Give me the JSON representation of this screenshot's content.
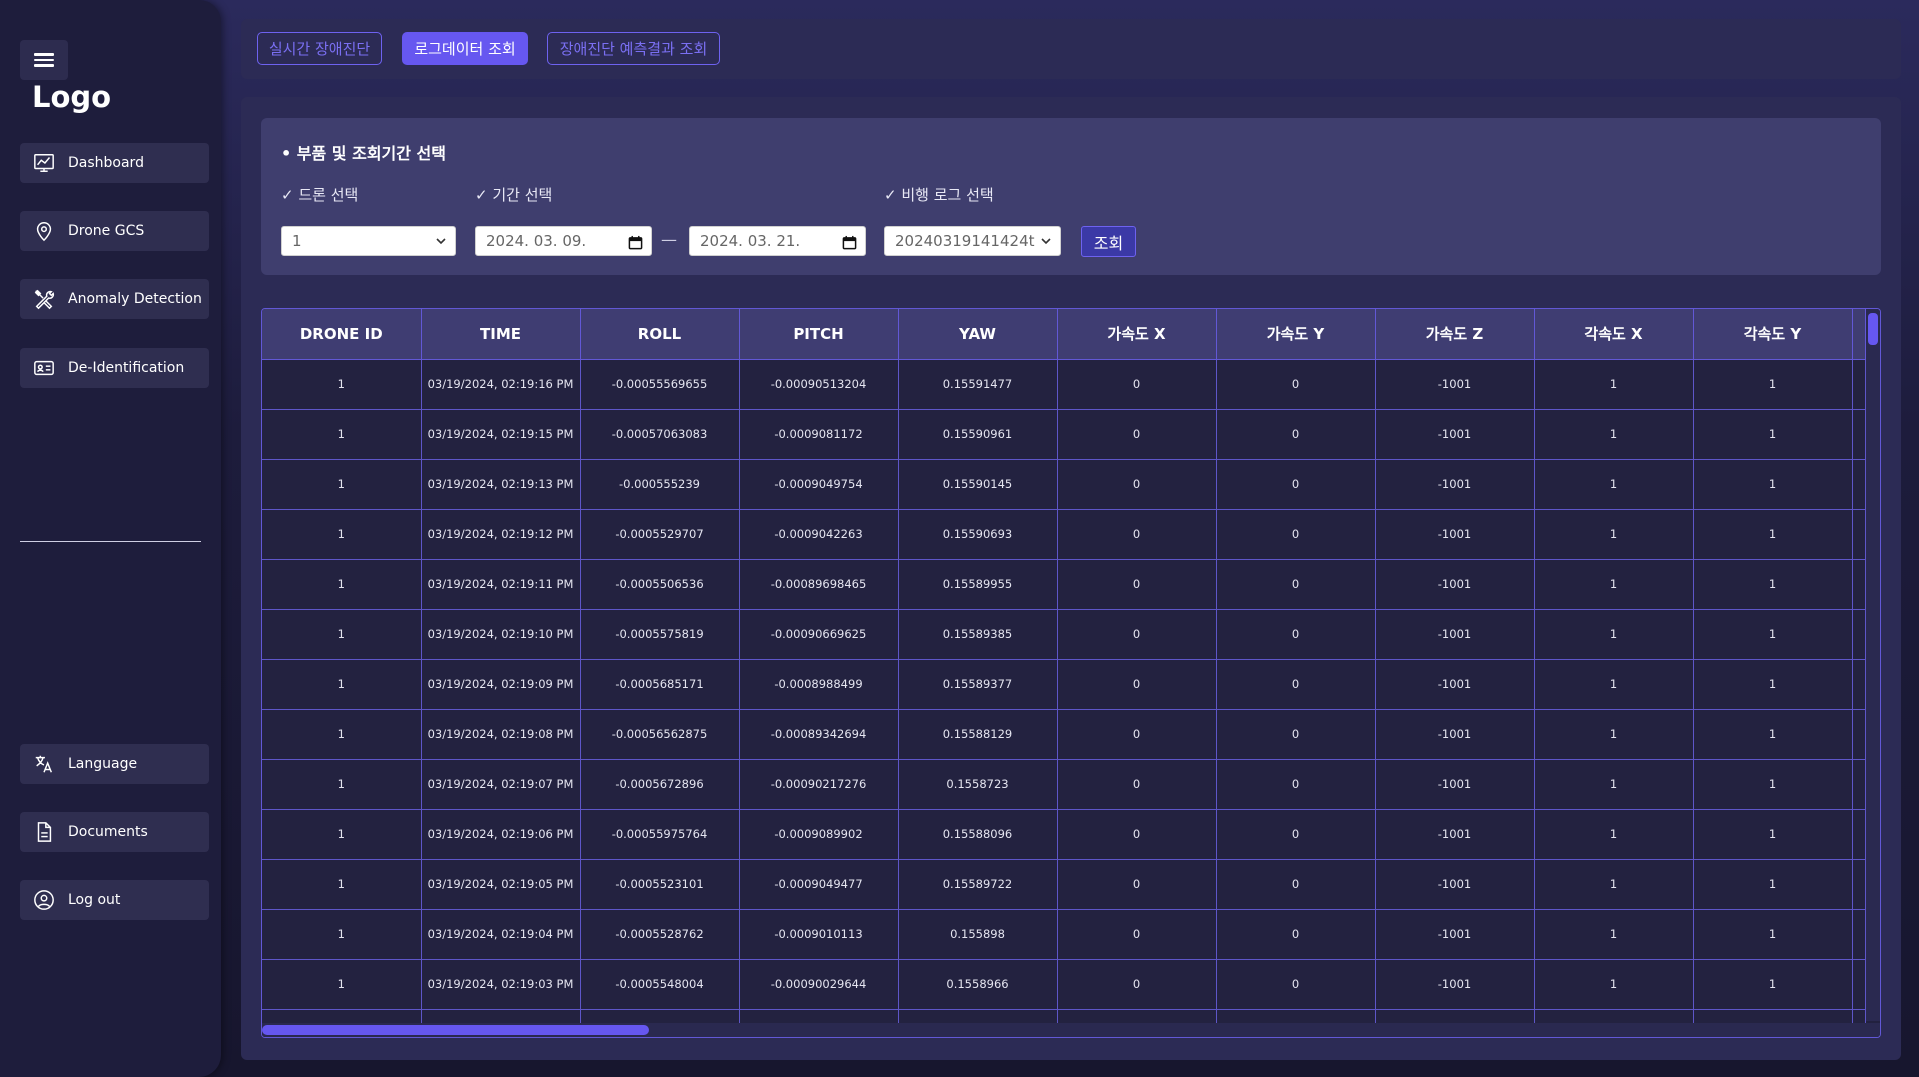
{
  "sidebar": {
    "logo": "Logo",
    "nav_top": [
      {
        "label": "Dashboard",
        "icon": "chart-icon"
      },
      {
        "label": "Drone GCS",
        "icon": "location-pin-icon"
      },
      {
        "label": "Anomaly Detection",
        "icon": "tools-icon"
      },
      {
        "label": "De-Identification",
        "icon": "id-card-icon"
      }
    ],
    "nav_bottom": [
      {
        "label": "Language",
        "icon": "translate-icon"
      },
      {
        "label": "Documents",
        "icon": "document-icon"
      },
      {
        "label": "Log out",
        "icon": "user-circle-icon"
      }
    ]
  },
  "tabs": [
    {
      "label": "실시간 장애진단",
      "active": false
    },
    {
      "label": "로그데이터 조회",
      "active": true
    },
    {
      "label": "장애진단 예측결과 조회",
      "active": false
    }
  ],
  "filter": {
    "title": "• 부품 및 조회기간 선택",
    "drone_label": "✓ 드론 선택",
    "period_label": "✓ 기간 선택",
    "log_label": "✓ 비행 로그 선택",
    "drone_value": "1",
    "start_date": "2024. 03. 09.",
    "date_separator": "—",
    "end_date": "2024. 03. 21.",
    "log_value": "20240319141424t",
    "search_button": "조회"
  },
  "table": {
    "columns": [
      "DRONE ID",
      "TIME",
      "ROLL",
      "PITCH",
      "YAW",
      "가속도 X",
      "가속도 Y",
      "가속도 Z",
      "각속도 X",
      "각속도 Y"
    ],
    "rows": [
      [
        "1",
        "03/19/2024, 02:19:16 PM",
        "-0.00055569655",
        "-0.00090513204",
        "0.15591477",
        "0",
        "0",
        "-1001",
        "1",
        "1"
      ],
      [
        "1",
        "03/19/2024, 02:19:15 PM",
        "-0.00057063083",
        "-0.0009081172",
        "0.15590961",
        "0",
        "0",
        "-1001",
        "1",
        "1"
      ],
      [
        "1",
        "03/19/2024, 02:19:13 PM",
        "-0.000555239",
        "-0.0009049754",
        "0.15590145",
        "0",
        "0",
        "-1001",
        "1",
        "1"
      ],
      [
        "1",
        "03/19/2024, 02:19:12 PM",
        "-0.0005529707",
        "-0.0009042263",
        "0.15590693",
        "0",
        "0",
        "-1001",
        "1",
        "1"
      ],
      [
        "1",
        "03/19/2024, 02:19:11 PM",
        "-0.0005506536",
        "-0.00089698465",
        "0.15589955",
        "0",
        "0",
        "-1001",
        "1",
        "1"
      ],
      [
        "1",
        "03/19/2024, 02:19:10 PM",
        "-0.0005575819",
        "-0.00090669625",
        "0.15589385",
        "0",
        "0",
        "-1001",
        "1",
        "1"
      ],
      [
        "1",
        "03/19/2024, 02:19:09 PM",
        "-0.0005685171",
        "-0.0008988499",
        "0.15589377",
        "0",
        "0",
        "-1001",
        "1",
        "1"
      ],
      [
        "1",
        "03/19/2024, 02:19:08 PM",
        "-0.00056562875",
        "-0.00089342694",
        "0.15588129",
        "0",
        "0",
        "-1001",
        "1",
        "1"
      ],
      [
        "1",
        "03/19/2024, 02:19:07 PM",
        "-0.0005672896",
        "-0.00090217276",
        "0.1558723",
        "0",
        "0",
        "-1001",
        "1",
        "1"
      ],
      [
        "1",
        "03/19/2024, 02:19:06 PM",
        "-0.00055975764",
        "-0.0009089902",
        "0.15588096",
        "0",
        "0",
        "-1001",
        "1",
        "1"
      ],
      [
        "1",
        "03/19/2024, 02:19:05 PM",
        "-0.0005523101",
        "-0.0009049477",
        "0.15589722",
        "0",
        "0",
        "-1001",
        "1",
        "1"
      ],
      [
        "1",
        "03/19/2024, 02:19:04 PM",
        "-0.0005528762",
        "-0.0009010113",
        "0.155898",
        "0",
        "0",
        "-1001",
        "1",
        "1"
      ],
      [
        "1",
        "03/19/2024, 02:19:03 PM",
        "-0.0005548004",
        "-0.00090029644",
        "0.1558966",
        "0",
        "0",
        "-1001",
        "1",
        "1"
      ],
      [
        "",
        "",
        "",
        "",
        "",
        "",
        "",
        "",
        "",
        ""
      ]
    ]
  },
  "colors": {
    "accent": "#6657f0",
    "sidebar_bg": "#1e1d3c",
    "panel_bg": "#2c2b55",
    "filter_bg": "#3f3e6e",
    "table_header_bg": "#3f3d72"
  }
}
